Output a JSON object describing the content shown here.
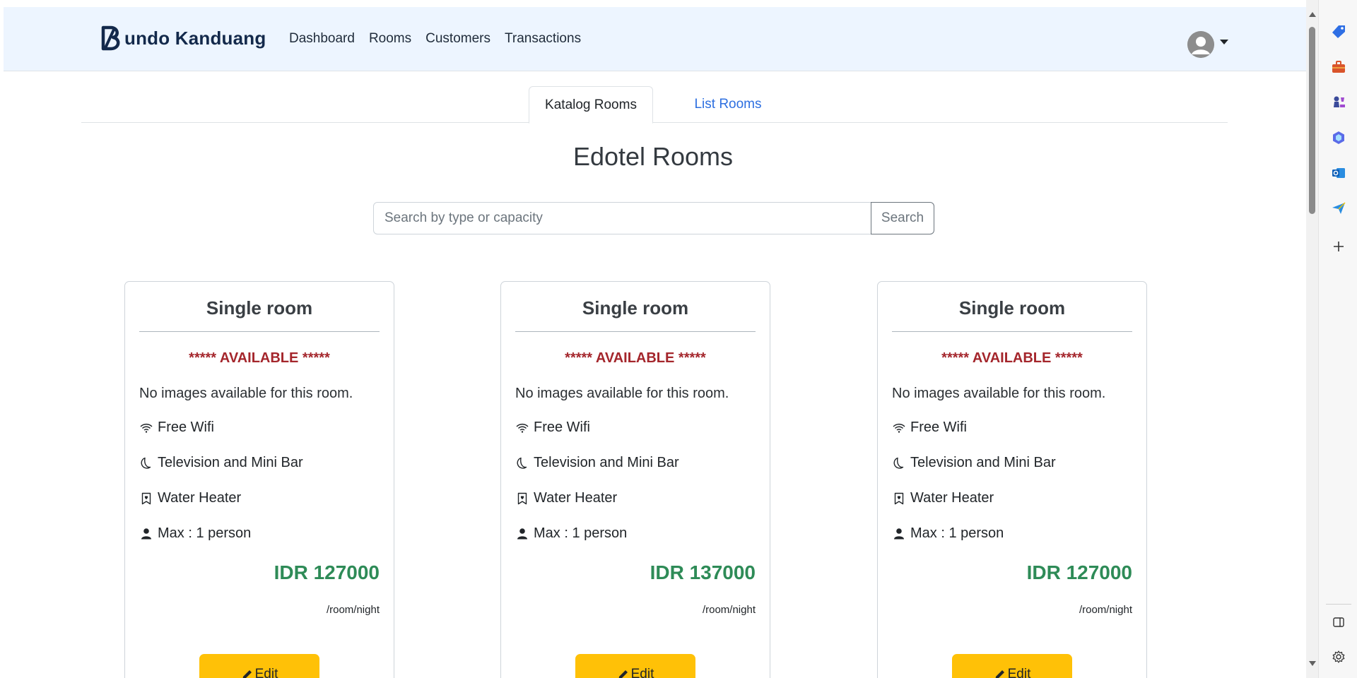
{
  "navbar": {
    "brand": "undo Kanduang",
    "links": [
      "Dashboard",
      "Rooms",
      "Customers",
      "Transactions"
    ]
  },
  "tabs": {
    "active": "Katalog Rooms",
    "other": "List Rooms"
  },
  "page_title": "Edotel Rooms",
  "search": {
    "placeholder": "Search by type or capacity",
    "button": "Search"
  },
  "cards": [
    {
      "title": "Single room",
      "status": "***** AVAILABLE *****",
      "no_images": "No images available for this room.",
      "features": [
        "Free Wifi",
        "Television and Mini Bar",
        "Water Heater",
        "Max : 1 person"
      ],
      "price": "IDR 127000",
      "unit": "/room/night",
      "edit": "Edit"
    },
    {
      "title": "Single room",
      "status": "***** AVAILABLE *****",
      "no_images": "No images available for this room.",
      "features": [
        "Free Wifi",
        "Television and Mini Bar",
        "Water Heater",
        "Max : 1 person"
      ],
      "price": "IDR 137000",
      "unit": "/room/night",
      "edit": "Edit"
    },
    {
      "title": "Single room",
      "status": "***** AVAILABLE *****",
      "no_images": "No images available for this room.",
      "features": [
        "Free Wifi",
        "Television and Mini Bar",
        "Water Heater",
        "Max : 1 person"
      ],
      "price": "IDR 127000",
      "unit": "/room/night",
      "edit": "Edit"
    }
  ],
  "sidebar_icons": [
    "tag-icon",
    "briefcase-icon",
    "chess-icon",
    "copilot-icon",
    "outlook-icon",
    "send-icon",
    "add-icon",
    "panel-icon",
    "settings-icon"
  ],
  "colors": {
    "navbar_bg": "#edf5ff",
    "available": "#a4262c",
    "price": "#2e8b57",
    "edit_button": "#ffc107",
    "link": "#2d6fe0"
  }
}
